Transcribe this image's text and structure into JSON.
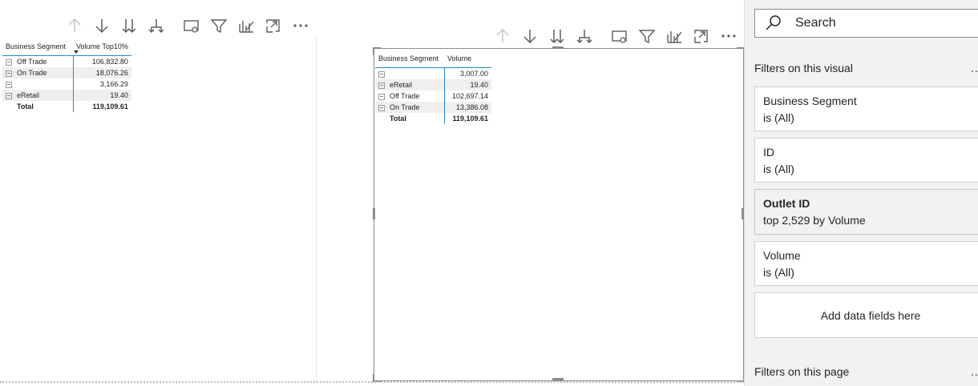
{
  "visual1": {
    "toolbar": [
      "arrow-up-icon",
      "arrow-down-icon",
      "double-arrow-down-icon",
      "expand-hierarchy-icon",
      "focus-mode-icon",
      "filter-icon",
      "analytics-icon",
      "expand-icon",
      "more-options-icon"
    ],
    "headers": [
      "Business Segment",
      "Volume Top10%"
    ],
    "rows": [
      {
        "segment": "Off Trade",
        "value": "106,832.80"
      },
      {
        "segment": "On Trade",
        "value": "18,076.26"
      },
      {
        "segment": "",
        "value": "3,166.29"
      },
      {
        "segment": "eRetail",
        "value": "19.40"
      }
    ],
    "total": {
      "label": "Total",
      "value": "119,109.61"
    }
  },
  "visual2": {
    "headers": [
      "Business Segment",
      "Volume"
    ],
    "rows": [
      {
        "segment": "",
        "value": "3,007.00"
      },
      {
        "segment": "eRetail",
        "value": "19.40"
      },
      {
        "segment": "Off Trade",
        "value": "102,697.14"
      },
      {
        "segment": "On Trade",
        "value": "13,386.08"
      }
    ],
    "total": {
      "label": "Total",
      "value": "119,109.61"
    }
  },
  "filter_pane": {
    "search_placeholder": "Search",
    "visual_section_title": "Filters on this visual",
    "more": "..",
    "filters": [
      {
        "field": "Business Segment",
        "condition": "is (All)"
      },
      {
        "field": "ID",
        "condition": "is (All)"
      },
      {
        "field": "Outlet ID",
        "condition": "top 2,529 by Volume"
      },
      {
        "field": "Volume",
        "condition": "is (All)"
      }
    ],
    "add_fields_label": "Add data fields here",
    "page_section_title": "Filters on this page"
  },
  "colors": {
    "accent_line": "#1f8bd6",
    "pane_bg": "#f3f2f1",
    "icon": "#605e5c"
  }
}
